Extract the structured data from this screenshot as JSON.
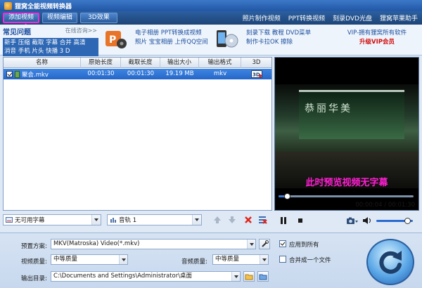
{
  "window": {
    "title": "狸窝全能视频转换器"
  },
  "toolbar": {
    "add_video": "添加视频",
    "video_edit": "视频编辑",
    "effect_3d": "3D效果",
    "links": [
      "照片制作视频",
      "PPT转换视频",
      "刻录DVD光盘",
      "狸窝苹果助手"
    ]
  },
  "faq": {
    "title": "常见问题",
    "more": "在线咨询>>",
    "lines": [
      "新手 压缩 截取 字幕 合并 高清",
      "消音 手机 片头 快播 3 D"
    ]
  },
  "promo": {
    "item1_line1": "电子相册 PPT转换成视频",
    "item1_line2": "照片 宝宝相册 上传QQ空间",
    "item2_line1": "刻录下载 教程 DVD菜单",
    "item2_line2": "制作卡拉OK 擦除",
    "vip_line1": "VIP-拥有狸窝所有软件",
    "vip_line2": "升级VIP会员"
  },
  "table": {
    "headers": [
      "名称",
      "原始长度",
      "截取长度",
      "输出大小",
      "输出格式",
      "3D"
    ],
    "rows": [
      {
        "name": "聚会.mkv",
        "original_length": "00:01:30",
        "clip_length": "00:01:30",
        "output_size": "19.19 MB",
        "output_format": "mkv",
        "checked": true
      }
    ]
  },
  "table_controls": {
    "subtitle": "无可用字幕",
    "audio_track": "音轨 1"
  },
  "preview": {
    "overlay_text": "此时预览视频无字幕",
    "scene_sign": "恭丽华美",
    "current_time": "00:00:04",
    "total_time": "00:01:30",
    "progress": 0.044,
    "volume": 0.85
  },
  "options": {
    "preset_label": "预置方案:",
    "preset_value": "MKV(Matroska) Video(*.mkv)",
    "apply_all_label": "应用到所有",
    "apply_all_checked": true,
    "video_quality_label": "视频质量:",
    "video_quality_value": "中等质量",
    "audio_quality_label": "音频质量:",
    "audio_quality_value": "中等质量",
    "merge_label": "合并成一个文件",
    "merge_checked": false,
    "output_dir_label": "输出目录:",
    "output_dir_value": "C:\\Documents and Settings\\Administrator\\桌面"
  },
  "colors": {
    "toolbar": "#1d4477",
    "selection": "#2566c8",
    "accent_magenta": "#ff1fd2",
    "vip_red": "#d10f0f"
  }
}
